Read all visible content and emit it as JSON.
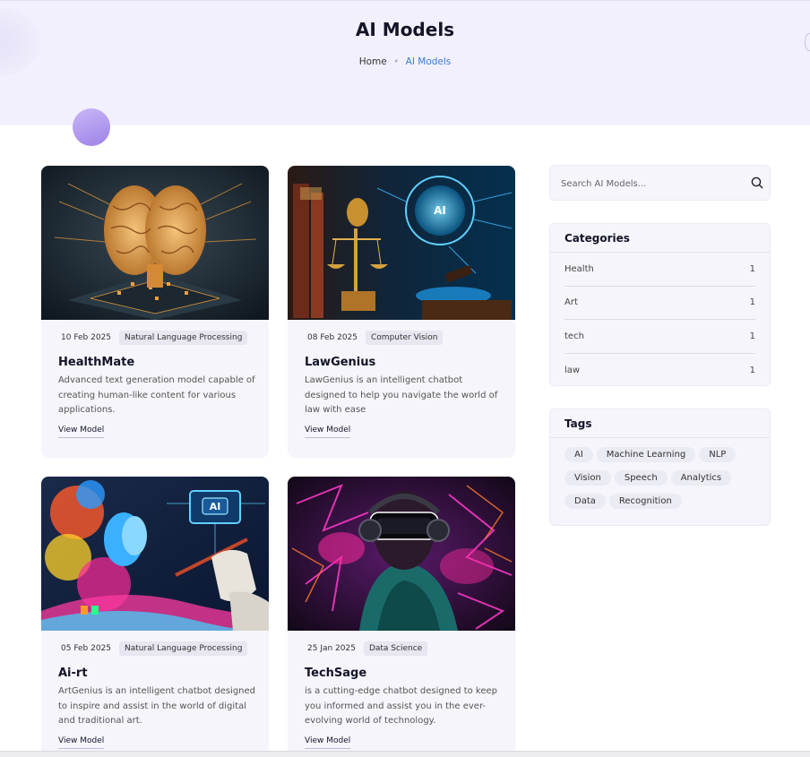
{
  "hero": {
    "title": "AI Models",
    "breadcrumb": {
      "home": "Home",
      "separator": "•",
      "current": "AI Models"
    }
  },
  "models": [
    {
      "date": "10 Feb 2025",
      "category": "Natural Language Processing",
      "title": "HealthMate",
      "description": "Advanced text generation model capable of creating human-like content for various applications.",
      "link": "View Model"
    },
    {
      "date": "08 Feb 2025",
      "category": "Computer Vision",
      "title": "LawGenius",
      "description": "LawGenius is an intelligent chatbot designed to help you navigate the world of law with ease",
      "link": "View Model"
    },
    {
      "date": "05 Feb 2025",
      "category": "Natural Language Processing",
      "title": "Ai-rt",
      "description": "ArtGenius is an intelligent chatbot designed to inspire and assist in the world of digital and traditional art.",
      "link": "View Model"
    },
    {
      "date": "25 Jan 2025",
      "category": "Data Science",
      "title": "TechSage",
      "description": "is a cutting-edge chatbot designed to keep you informed and assist you in the ever-evolving world of technology.",
      "link": "View Model"
    }
  ],
  "sidebar": {
    "search": {
      "placeholder": "Search AI Models...",
      "icon": "search-icon"
    },
    "categories": {
      "title": "Categories",
      "items": [
        {
          "name": "Health",
          "count": "1"
        },
        {
          "name": "Art",
          "count": "1"
        },
        {
          "name": "tech",
          "count": "1"
        },
        {
          "name": "law",
          "count": "1"
        }
      ]
    },
    "tags": {
      "title": "Tags",
      "items": [
        "AI",
        "Machine Learning",
        "NLP",
        "Vision",
        "Speech",
        "Analytics",
        "Data",
        "Recognition"
      ]
    }
  },
  "colors": {
    "accent": "#3a7bd5",
    "hero_bg": "#f2f0fd",
    "card_bg": "#f5f5fb"
  }
}
